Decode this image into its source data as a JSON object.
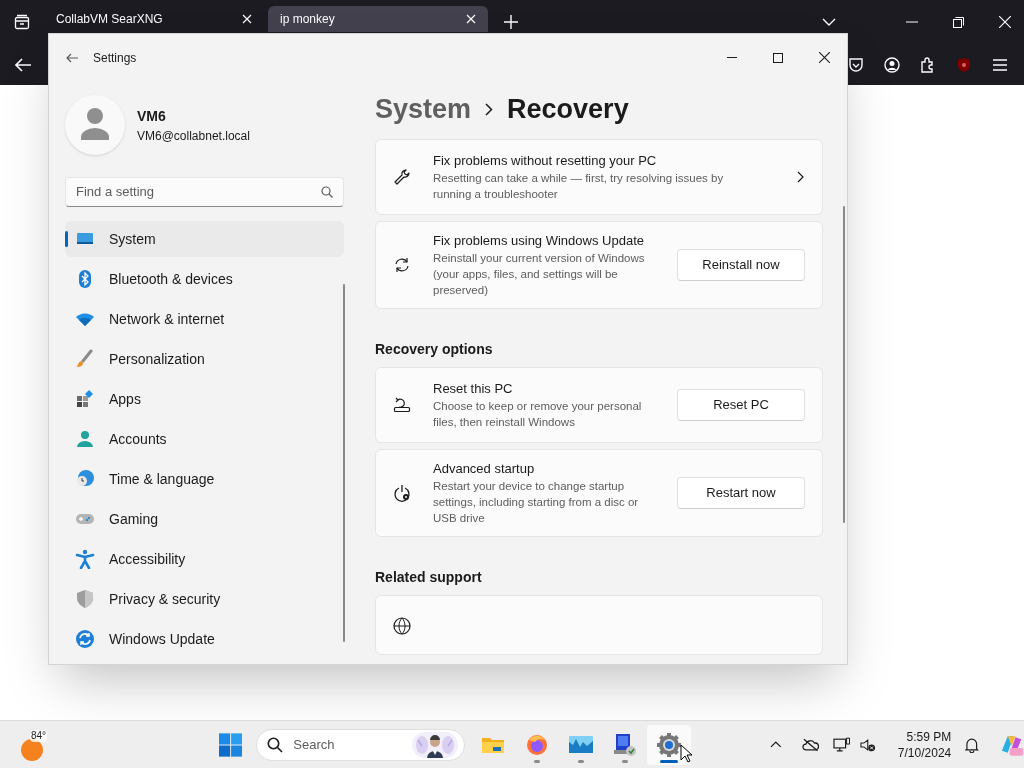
{
  "browser": {
    "tabs": [
      {
        "title": "CollabVM SearXNG",
        "selected": false
      },
      {
        "title": "ip monkey",
        "selected": true
      }
    ]
  },
  "settings": {
    "title": "Settings",
    "user": {
      "name": "VM6",
      "email": "VM6@collabnet.local"
    },
    "search": {
      "placeholder": "Find a setting"
    },
    "nav": [
      {
        "label": "System",
        "selected": true
      },
      {
        "label": "Bluetooth & devices",
        "selected": false
      },
      {
        "label": "Network & internet",
        "selected": false
      },
      {
        "label": "Personalization",
        "selected": false
      },
      {
        "label": "Apps",
        "selected": false
      },
      {
        "label": "Accounts",
        "selected": false
      },
      {
        "label": "Time & language",
        "selected": false
      },
      {
        "label": "Gaming",
        "selected": false
      },
      {
        "label": "Accessibility",
        "selected": false
      },
      {
        "label": "Privacy & security",
        "selected": false
      },
      {
        "label": "Windows Update",
        "selected": false
      }
    ],
    "breadcrumb": {
      "parent": "System",
      "current": "Recovery"
    },
    "sections": [
      {
        "cards": [
          {
            "kind": "link",
            "title": "Fix problems without resetting your PC",
            "description": "Resetting can take a while — first, try resolving issues by running a troubleshooter"
          },
          {
            "kind": "button",
            "title": "Fix problems using Windows Update",
            "description": "Reinstall your current version of Windows (your apps, files, and settings will be preserved)",
            "button": "Reinstall now"
          }
        ]
      },
      {
        "heading": "Recovery options",
        "cards": [
          {
            "kind": "button",
            "title": "Reset this PC",
            "description": "Choose to keep or remove your personal files, then reinstall Windows",
            "button": "Reset PC"
          },
          {
            "kind": "button",
            "title": "Advanced startup",
            "description": "Restart your device to change startup settings, including starting from a disc or USB drive",
            "button": "Restart now"
          }
        ]
      },
      {
        "heading": "Related support",
        "cards": [
          {
            "kind": "partial"
          }
        ]
      }
    ]
  },
  "taskbar": {
    "weather": "84°",
    "search": {
      "placeholder": "Search"
    },
    "apps": [
      {
        "running": false,
        "selected": false
      },
      {
        "running": true,
        "selected": false
      },
      {
        "running": true,
        "selected": false
      },
      {
        "running": true,
        "selected": false
      },
      {
        "running": true,
        "selected": true
      }
    ],
    "clock": {
      "time": "5:59 PM",
      "date": "7/10/2024"
    }
  }
}
